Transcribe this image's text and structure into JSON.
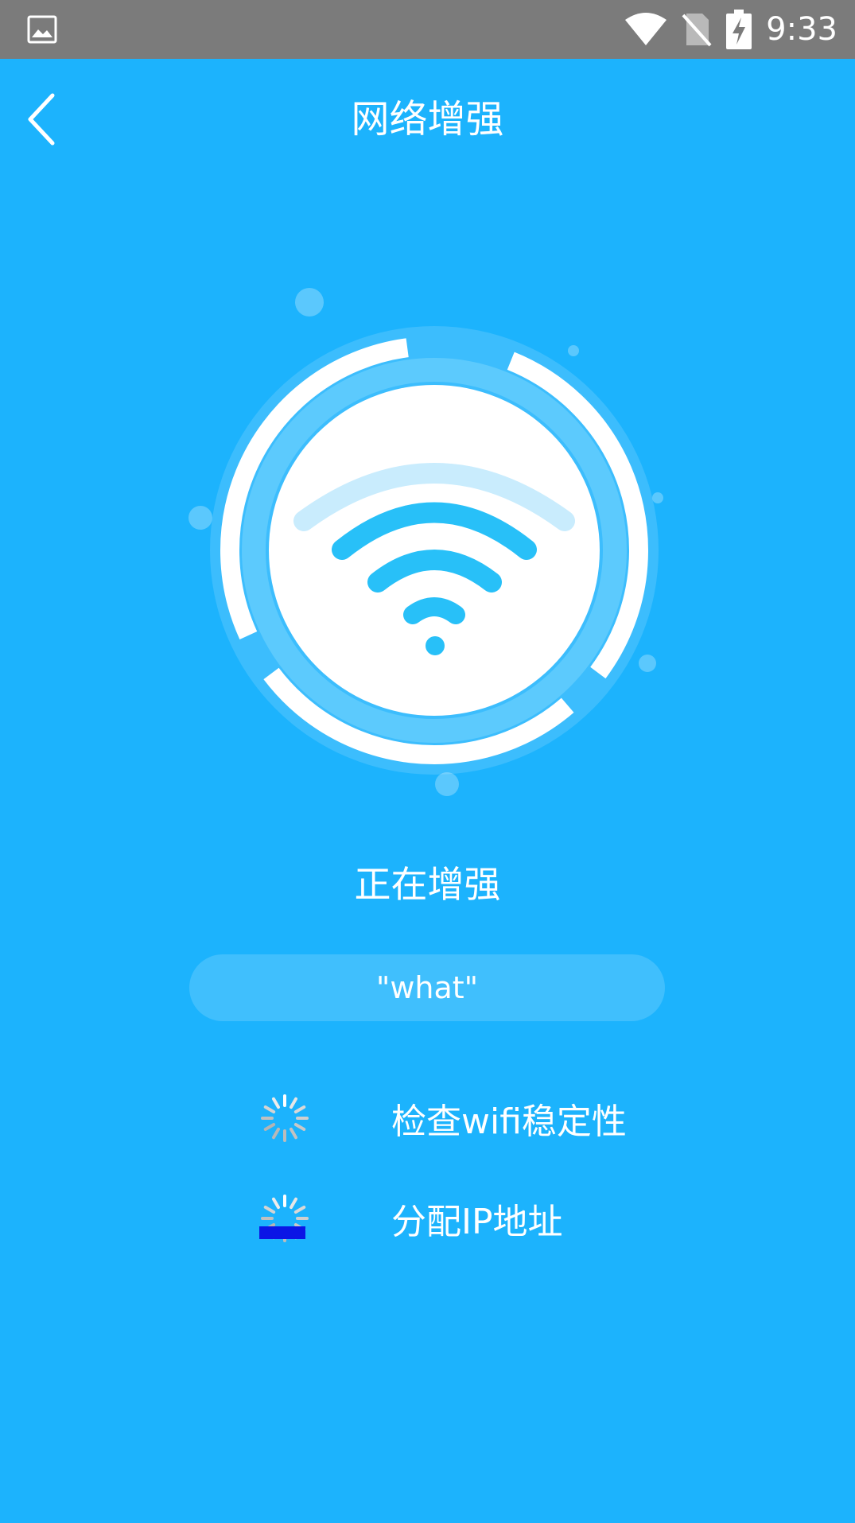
{
  "status_bar": {
    "time": "9:33",
    "icons": [
      "gallery-icon",
      "wifi-icon",
      "no-sim-icon",
      "battery-charging-icon"
    ]
  },
  "app_bar": {
    "back_icon": "chevron-left-icon",
    "title": "网络增强"
  },
  "main": {
    "status_heading": "正在增强",
    "ssid": "\"what\"",
    "tasks": [
      {
        "label": "检查wifi稳定性",
        "icon": "loading-spinner-icon"
      },
      {
        "label": "分配IP地址",
        "icon": "loading-spinner-icon"
      }
    ]
  },
  "colors": {
    "background": "#1cb3fd",
    "status_bar": "#7b7b7b",
    "wifi_icon": "#28c0f8",
    "ring_light": "#5ccafd",
    "spinner_highlight": "#0b16e6"
  }
}
